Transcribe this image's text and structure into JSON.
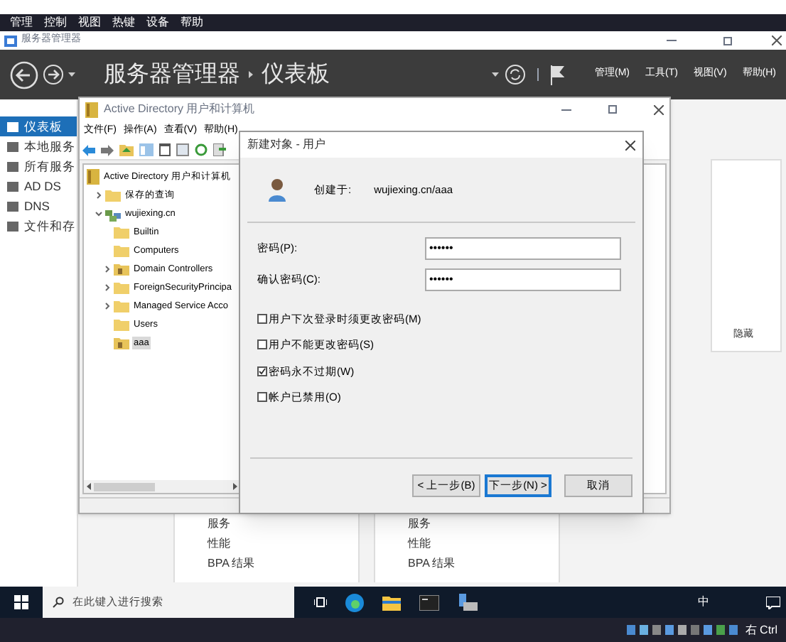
{
  "vbox_menu": [
    "管理",
    "控制",
    "视图",
    "热键",
    "设备",
    "帮助"
  ],
  "server_manager": {
    "title": "服务器管理器",
    "breadcrumb": [
      "服务器管理器",
      "仪表板"
    ],
    "menus": [
      "管理(M)",
      "工具(T)",
      "视图(V)",
      "帮助(H)"
    ],
    "sidebar": [
      {
        "label": "仪表板",
        "selected": true
      },
      {
        "label": "本地服务",
        "selected": false
      },
      {
        "label": "所有服务",
        "selected": false
      },
      {
        "label": "AD DS",
        "selected": false
      },
      {
        "label": "DNS",
        "selected": false
      },
      {
        "label": "文件和存",
        "selected": false
      }
    ],
    "hide_link": "隐藏",
    "tiles": [
      {
        "items": [
          "服务",
          "性能",
          "BPA 结果"
        ]
      },
      {
        "items": [
          "服务",
          "性能",
          "BPA 结果"
        ]
      }
    ]
  },
  "aduc": {
    "title": "Active Directory 用户和计算机",
    "menus": [
      "文件(F)",
      "操作(A)",
      "查看(V)",
      "帮助(H)"
    ],
    "tree": [
      {
        "label": "Active Directory 用户和计算机",
        "kind": "root",
        "expanded": true,
        "children": [
          {
            "label": "保存的查询",
            "kind": "folder",
            "expanded": false,
            "has_children": true
          },
          {
            "label": "wujiexing.cn",
            "kind": "domain",
            "expanded": true,
            "has_children": true,
            "children": [
              {
                "label": "Builtin",
                "kind": "folder",
                "has_children": false,
                "selected": false
              },
              {
                "label": "Computers",
                "kind": "folder",
                "has_children": false,
                "selected": false
              },
              {
                "label": "Domain Controllers",
                "kind": "ou",
                "has_children": true,
                "selected": false
              },
              {
                "label": "ForeignSecurityPrincipa",
                "kind": "folder",
                "has_children": true,
                "selected": false
              },
              {
                "label": "Managed Service Acco",
                "kind": "folder",
                "has_children": true,
                "selected": false
              },
              {
                "label": "Users",
                "kind": "folder",
                "has_children": false,
                "selected": false
              },
              {
                "label": "aaa",
                "kind": "ou",
                "has_children": false,
                "selected": true
              }
            ]
          }
        ]
      }
    ]
  },
  "dialog": {
    "title": "新建对象 - 用户",
    "created_in_label": "创建于:",
    "created_in": "wujiexing.cn/aaa",
    "fields": [
      {
        "label": "密码(P):",
        "value": "••••••"
      },
      {
        "label": "确认密码(C):",
        "value": "••••••"
      }
    ],
    "options": [
      {
        "label": "用户下次登录时须更改密码(M)",
        "checked": false
      },
      {
        "label": "用户不能更改密码(S)",
        "checked": false
      },
      {
        "label": "密码永不过期(W)",
        "checked": true
      },
      {
        "label": "帐户已禁用(O)",
        "checked": false
      }
    ],
    "buttons": [
      {
        "label": "< 上一步(B)",
        "default": false
      },
      {
        "label": "下一步(N) >",
        "default": true
      },
      {
        "label": "取消",
        "default": false
      }
    ]
  },
  "taskbar": {
    "search_placeholder": "在此键入进行搜索",
    "tray_text": "中"
  },
  "vbox_status": "右 Ctrl"
}
